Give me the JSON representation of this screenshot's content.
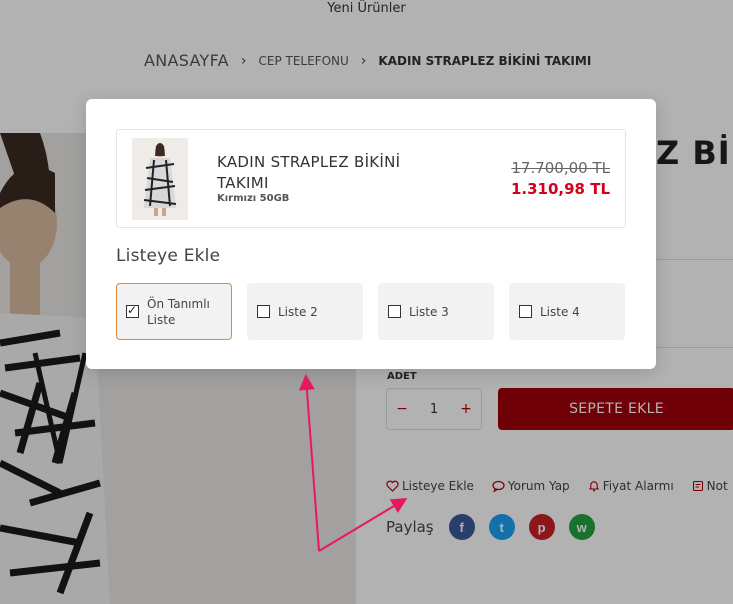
{
  "header": {
    "top_link": "Yeni Ürünler",
    "breadcrumb": [
      "ANASAYFA",
      "CEP TELEFONU",
      "KADIN STRAPLEZ BİKİNİ TAKIMI"
    ]
  },
  "product_page": {
    "title_fragment": "Z Bİ",
    "quantity_label": "ADET",
    "quantity_value": "1",
    "minus": "−",
    "plus": "+",
    "add_to_cart": "SEPETE EKLE",
    "actions": [
      "Listeye Ekle",
      "Yorum Yap",
      "Fiyat Alarmı",
      "Not"
    ],
    "share_label": "Paylaş",
    "social": [
      {
        "icon": "facebook-icon",
        "glyph": "f",
        "color": "#3b5998"
      },
      {
        "icon": "twitter-icon",
        "glyph": "t",
        "color": "#1da1f2"
      },
      {
        "icon": "pinterest-icon",
        "glyph": "p",
        "color": "#cb2027"
      },
      {
        "icon": "whatsapp-icon",
        "glyph": "w",
        "color": "#25a244"
      }
    ]
  },
  "modal": {
    "product": {
      "name": "KADIN STRAPLEZ BİKİNİ TAKIMI",
      "variant": "Kırmızı 50GB",
      "old_price": "17.700,00 TL",
      "new_price": "1.310,98 TL"
    },
    "section_title": "Listeye Ekle",
    "lists": [
      {
        "label": "Ön Tanımlı Liste",
        "checked": true
      },
      {
        "label": "Liste 2",
        "checked": false
      },
      {
        "label": "Liste 3",
        "checked": false
      },
      {
        "label": "Liste 4",
        "checked": false
      }
    ]
  },
  "colors": {
    "accent_red": "#a0000b",
    "price_red": "#d0021b",
    "selected_border": "#e08a3a",
    "annotation_pink": "#e8185f"
  }
}
